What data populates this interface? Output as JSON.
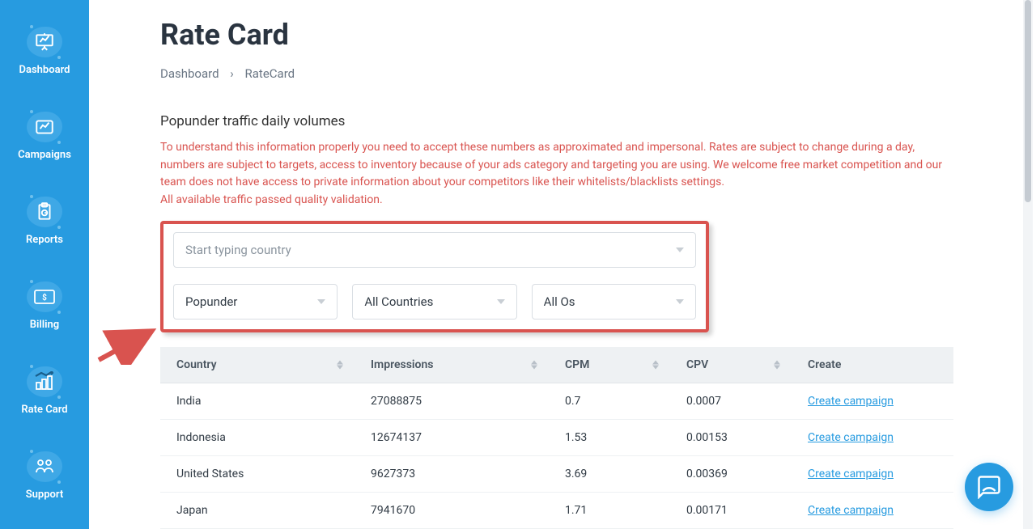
{
  "sidebar": {
    "items": [
      {
        "label": "Dashboard"
      },
      {
        "label": "Campaigns"
      },
      {
        "label": "Reports"
      },
      {
        "label": "Billing"
      },
      {
        "label": "Rate Card"
      },
      {
        "label": "Support"
      }
    ]
  },
  "page": {
    "title": "Rate Card"
  },
  "breadcrumb": {
    "home": "Dashboard",
    "sep": "›",
    "current": "RateCard"
  },
  "section": {
    "heading": "Popunder traffic daily volumes",
    "warning_part1": "To understand this information properly you need to accept these numbers as approximated and impersonal. Rates are subject to change during a day, numbers are subject to targets, access to inventory because of your ads category and targeting you are using. We welcome free market competition and our team does not have access to private information about your competitors like their whitelists/blacklists settings.",
    "warning_part2": "All available traffic passed quality validation."
  },
  "filters": {
    "country_search_placeholder": "Start typing country",
    "type": "Popunder",
    "region": "All Countries",
    "os": "All Os"
  },
  "table": {
    "headers": {
      "country": "Country",
      "impressions": "Impressions",
      "cpm": "CPM",
      "cpv": "CPV",
      "create": "Create"
    },
    "create_link": "Create campaign",
    "rows": [
      {
        "country": "India",
        "impressions": "27088875",
        "cpm": "0.7",
        "cpv": "0.0007"
      },
      {
        "country": "Indonesia",
        "impressions": "12674137",
        "cpm": "1.53",
        "cpv": "0.00153"
      },
      {
        "country": "United States",
        "impressions": "9627373",
        "cpm": "3.69",
        "cpv": "0.00369"
      },
      {
        "country": "Japan",
        "impressions": "7941670",
        "cpm": "1.71",
        "cpv": "0.00171"
      }
    ]
  },
  "colors": {
    "accent": "#279be0",
    "danger": "#d9534f"
  }
}
